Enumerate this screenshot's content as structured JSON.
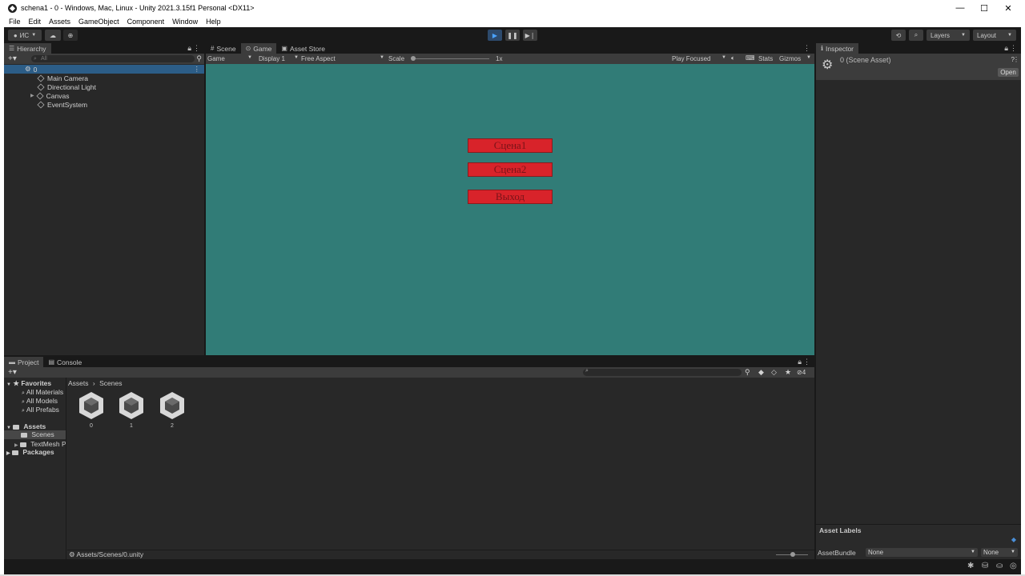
{
  "window": {
    "title": "schena1 - 0 - Windows, Mac, Linux - Unity 2021.3.15f1 Personal <DX11>",
    "minimize": "—",
    "maximize": "☐",
    "close": "✕"
  },
  "menu": [
    "File",
    "Edit",
    "Assets",
    "GameObject",
    "Component",
    "Window",
    "Help"
  ],
  "toolbar": {
    "account": "ИС",
    "layers": "Layers",
    "layout": "Layout"
  },
  "hierarchy": {
    "tab": "Hierarchy",
    "search_placeholder": "All",
    "scene": "0",
    "items": [
      "Main Camera",
      "Directional Light",
      "Canvas",
      "EventSystem"
    ]
  },
  "game": {
    "tabs": [
      "Scene",
      "Game",
      "Asset Store"
    ],
    "display_mode": "Game",
    "display": "Display 1",
    "aspect": "Free Aspect",
    "scale_label": "Scale",
    "scale_value": "1x",
    "play_mode": "Play Focused",
    "stats": "Stats",
    "gizmos": "Gizmos",
    "canvas_color": "#317c77",
    "buttons": [
      "Сцена1",
      "Сцена2",
      "Выход"
    ],
    "button_color": "#d8232a"
  },
  "inspector": {
    "tab": "Inspector",
    "asset_name": "0 (Scene Asset)",
    "open": "Open",
    "asset_labels": "Asset Labels",
    "assetbundle_label": "AssetBundle",
    "assetbundle_value": "None",
    "variant_value": "None"
  },
  "project": {
    "tabs": [
      "Project",
      "Console"
    ],
    "favorites": "Favorites",
    "fav_items": [
      "All Materials",
      "All Models",
      "All Prefabs"
    ],
    "assets_root": "Assets",
    "asset_folders": [
      "Scenes",
      "TextMesh Pro"
    ],
    "packages": "Packages",
    "breadcrumb": [
      "Assets",
      "Scenes"
    ],
    "files": [
      "0",
      "1",
      "2"
    ],
    "hidden_count": "4",
    "path": "Assets/Scenes/0.unity"
  }
}
